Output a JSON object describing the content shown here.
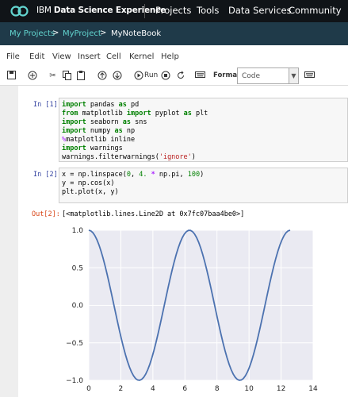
{
  "header": {
    "brand_prefix": "IBM",
    "brand_name": "Data Science Experience",
    "nav": [
      "Projects",
      "Tools",
      "Data Services",
      "Community"
    ]
  },
  "breadcrumb": {
    "items": [
      "My Projects",
      "MyProject",
      "MyNoteBook"
    ],
    "separator": ">"
  },
  "menubar": {
    "items": [
      "File",
      "Edit",
      "View",
      "Insert",
      "Cell",
      "Kernel",
      "Help"
    ]
  },
  "toolbar": {
    "run_label": "Run",
    "format_label": "Format",
    "cell_type": "Code",
    "icons": [
      "save-icon",
      "add-cell-icon",
      "cut-icon",
      "copy-icon",
      "paste-icon",
      "move-up-icon",
      "move-down-icon",
      "run-icon",
      "stop-icon",
      "restart-icon",
      "keyboard-icon",
      "command-palette-icon"
    ]
  },
  "cells": [
    {
      "prompt": "In [1]:",
      "lines": [
        "import pandas as pd",
        "from matplotlib import pyplot as plt",
        "import seaborn as sns",
        "import numpy as np",
        "%matplotlib inline",
        "import warnings",
        "warnings.filterwarnings('ignore')"
      ]
    },
    {
      "prompt": "In [2]:",
      "lines": [
        "x = np.linspace(0, 4. * np.pi, 100)",
        "y = np.cos(x)",
        "plt.plot(x, y)"
      ]
    }
  ],
  "output": {
    "prompt": "Out[2]:",
    "text": "[<matplotlib.lines.Line2D at 0x7fc07baa4be0>]"
  },
  "chart_data": {
    "type": "line",
    "title": "",
    "xlabel": "",
    "ylabel": "",
    "xlim": [
      0,
      14
    ],
    "ylim": [
      -1.0,
      1.0
    ],
    "xticks": [
      0,
      2,
      4,
      6,
      8,
      10,
      12,
      14
    ],
    "yticks": [
      1.0,
      0.5,
      0.0,
      -0.5,
      -1.0
    ],
    "xtick_labels": [
      "0",
      "2",
      "4",
      "6",
      "8",
      "10",
      "12",
      "14"
    ],
    "ytick_labels": [
      "1.0",
      "0.5",
      "0.0",
      "−0.5",
      "−1.0"
    ],
    "grid": true,
    "style": "seaborn-darkgrid",
    "series": [
      {
        "function": "cos(x)",
        "x_range": [
          0,
          12.566
        ],
        "points": 100,
        "x": [
          0,
          1.571,
          3.142,
          4.712,
          6.283,
          7.854,
          9.425,
          10.996,
          12.566
        ],
        "y": [
          1,
          0,
          -1,
          0,
          1,
          0,
          -1,
          0,
          1
        ],
        "color": "#4c72b0"
      }
    ]
  },
  "colors": {
    "topbar": "#101418",
    "crumbbar": "#1f3a49",
    "crumb_link": "#62d4cf",
    "plot_bg": "#eaeaf2",
    "line": "#4c72b0"
  }
}
